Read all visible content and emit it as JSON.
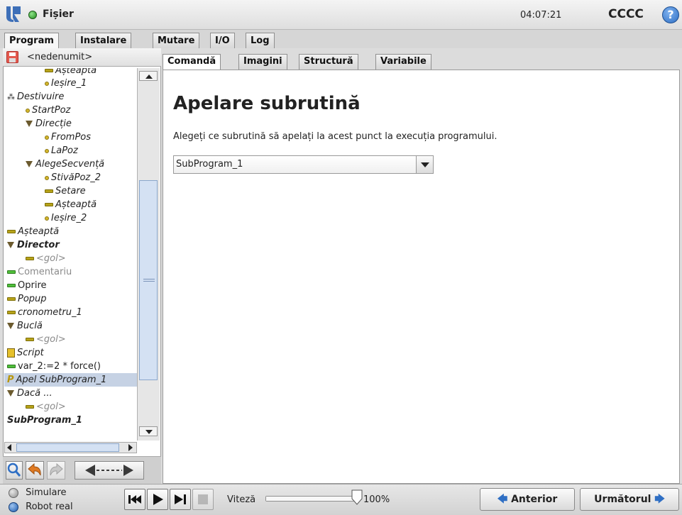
{
  "header": {
    "menu_label": "Fișier",
    "clock": "04:07:21",
    "robot_name": "CCCC",
    "help_symbol": "?"
  },
  "main_tabs": [
    {
      "label": "Program"
    },
    {
      "label": "Instalare"
    },
    {
      "label": "Mutare"
    },
    {
      "label": "I/O"
    },
    {
      "label": "Log"
    }
  ],
  "file": {
    "name": "<nedenumit>"
  },
  "tree": {
    "items": [
      {
        "label": "Așteaptă"
      },
      {
        "label": "Ieșire_1"
      },
      {
        "label": "Destivuire"
      },
      {
        "label": "StartPoz"
      },
      {
        "label": "Direcție"
      },
      {
        "label": "FromPos"
      },
      {
        "label": "LaPoz"
      },
      {
        "label": "AlegeSecvență"
      },
      {
        "label": "StivăPoz_2"
      },
      {
        "label": "Setare"
      },
      {
        "label": "Așteaptă"
      },
      {
        "label": "Ieșire_2"
      },
      {
        "label": "Așteaptă"
      },
      {
        "label": "Director"
      },
      {
        "label": "<gol>"
      },
      {
        "label": "Comentariu"
      },
      {
        "label": "Oprire"
      },
      {
        "label": "Popup"
      },
      {
        "label": "cronometru_1"
      },
      {
        "label": "Buclă"
      },
      {
        "label": "<gol>"
      },
      {
        "label": "Script"
      },
      {
        "label": "var_2:=2 * force()"
      },
      {
        "label": "Apel SubProgram_1"
      },
      {
        "label": "Dacă ..."
      },
      {
        "label": "<gol>"
      },
      {
        "label": "SubProgram_1"
      }
    ]
  },
  "sub_tabs": [
    {
      "label": "Comandă"
    },
    {
      "label": "Imagini"
    },
    {
      "label": "Structură"
    },
    {
      "label": "Variabile"
    }
  ],
  "content": {
    "title": "Apelare subrutină",
    "description": "Alegeți ce subrutină să apelați la acest punct la execuția programului.",
    "selected_subprogram": "SubProgram_1"
  },
  "footer": {
    "mode_simulation": "Simulare",
    "mode_real": "Robot real",
    "speed_label": "Viteză",
    "speed_value": "100%",
    "speed_fraction": 1.0,
    "prev_label": "Anterior",
    "next_label": "Următorul"
  },
  "colors": {
    "accent_blue": "#2f6fc4",
    "selection": "#c6d2e4",
    "tree_bar": "#b7a31a"
  }
}
